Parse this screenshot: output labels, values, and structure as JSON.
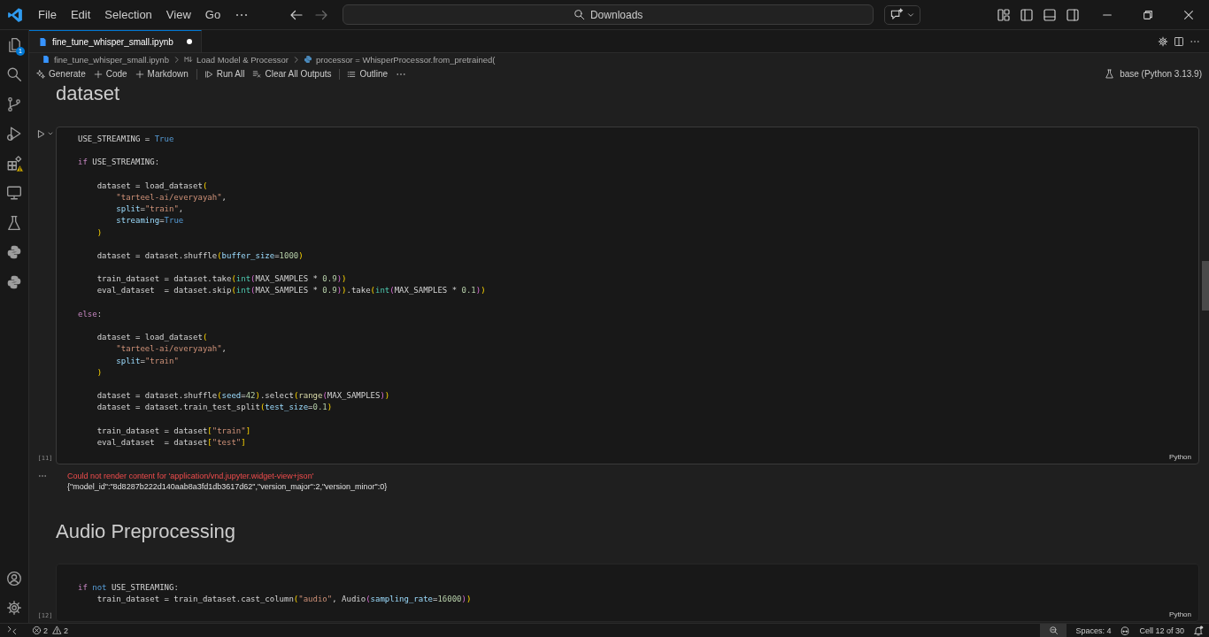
{
  "title_bar": {
    "menus": [
      "File",
      "Edit",
      "Selection",
      "View",
      "Go"
    ],
    "command_center": "Downloads"
  },
  "activity_bar": {
    "explorer_badge": "1"
  },
  "tabs": [
    {
      "label": "fine_tune_whisper_small.ipynb",
      "selected": true,
      "modified": true
    }
  ],
  "breadcrumbs": [
    {
      "text": "fine_tune_whisper_small.ipynb",
      "kind": "file"
    },
    {
      "text": "Load Model & Processor",
      "kind": "markdown"
    },
    {
      "text": "processor = WhisperProcessor.from_pretrained(",
      "kind": "python"
    }
  ],
  "toolbar": {
    "items": [
      {
        "label": "Generate",
        "kind": "sparkle"
      },
      {
        "label": "Code",
        "kind": "plus"
      },
      {
        "label": "Markdown",
        "kind": "plus"
      },
      {
        "label": "Run All",
        "kind": "run-all"
      },
      {
        "label": "Clear All Outputs",
        "kind": "clear"
      },
      {
        "label": "Outline",
        "kind": "list"
      }
    ],
    "kernel": "base (Python 3.13.9)"
  },
  "notebook": [
    {
      "kind": "heading",
      "text": "dataset"
    },
    {
      "kind": "code",
      "focused": true,
      "execution_count": "[11]",
      "language": "Python",
      "lines": [
        {
          "kind": "code",
          "tokens": [
            {
              "text": "USE_STREAMING = ",
              "kind": "plain"
            },
            {
              "text": "True",
              "kind": "const"
            }
          ]
        },
        {
          "kind": "blank"
        },
        {
          "kind": "code",
          "tokens": [
            {
              "text": "if",
              "kind": "kw"
            },
            {
              "text": " USE_STREAMING:",
              "kind": "plain"
            }
          ]
        },
        {
          "kind": "blank"
        },
        {
          "kind": "code",
          "tokens": [
            {
              "text": "    dataset = load_dataset",
              "kind": "plain"
            },
            {
              "text": "(",
              "kind": "b1"
            }
          ]
        },
        {
          "kind": "code",
          "tokens": [
            {
              "text": "        \"tarteel-ai/everyayah\"",
              "kind": "str"
            },
            {
              "text": ",",
              "kind": "plain"
            }
          ]
        },
        {
          "kind": "code",
          "tokens": [
            {
              "text": "        split",
              "kind": "param"
            },
            {
              "text": "=",
              "kind": "plain"
            },
            {
              "text": "\"train\"",
              "kind": "str"
            },
            {
              "text": ",",
              "kind": "plain"
            }
          ]
        },
        {
          "kind": "code",
          "tokens": [
            {
              "text": "        streaming",
              "kind": "param"
            },
            {
              "text": "=",
              "kind": "plain"
            },
            {
              "text": "True",
              "kind": "const"
            }
          ]
        },
        {
          "kind": "code",
          "tokens": [
            {
              "text": "    )",
              "kind": "b1"
            }
          ]
        },
        {
          "kind": "blank"
        },
        {
          "kind": "code",
          "tokens": [
            {
              "text": "    dataset = dataset.shuffle",
              "kind": "plain"
            },
            {
              "text": "(",
              "kind": "b1"
            },
            {
              "text": "buffer_size",
              "kind": "param"
            },
            {
              "text": "=",
              "kind": "plain"
            },
            {
              "text": "1000",
              "kind": "num"
            },
            {
              "text": ")",
              "kind": "b1"
            }
          ]
        },
        {
          "kind": "blank"
        },
        {
          "kind": "code",
          "tokens": [
            {
              "text": "    train_dataset = dataset.take",
              "kind": "plain"
            },
            {
              "text": "(",
              "kind": "b1"
            },
            {
              "text": "int",
              "kind": "cls"
            },
            {
              "text": "(",
              "kind": "b2"
            },
            {
              "text": "MAX_SAMPLES * ",
              "kind": "plain"
            },
            {
              "text": "0.9",
              "kind": "num"
            },
            {
              "text": ")",
              "kind": "b2"
            },
            {
              "text": ")",
              "kind": "b1"
            }
          ]
        },
        {
          "kind": "code",
          "tokens": [
            {
              "text": "    eval_dataset  = dataset.skip",
              "kind": "plain"
            },
            {
              "text": "(",
              "kind": "b1"
            },
            {
              "text": "int",
              "kind": "cls"
            },
            {
              "text": "(",
              "kind": "b2"
            },
            {
              "text": "MAX_SAMPLES * ",
              "kind": "plain"
            },
            {
              "text": "0.9",
              "kind": "num"
            },
            {
              "text": ")",
              "kind": "b2"
            },
            {
              "text": ")",
              "kind": "b1"
            },
            {
              "text": ".take",
              "kind": "plain"
            },
            {
              "text": "(",
              "kind": "b1"
            },
            {
              "text": "int",
              "kind": "cls"
            },
            {
              "text": "(",
              "kind": "b2"
            },
            {
              "text": "MAX_SAMPLES * ",
              "kind": "plain"
            },
            {
              "text": "0.1",
              "kind": "num"
            },
            {
              "text": ")",
              "kind": "b2"
            },
            {
              "text": ")",
              "kind": "b1"
            }
          ]
        },
        {
          "kind": "blank"
        },
        {
          "kind": "code",
          "tokens": [
            {
              "text": "else",
              "kind": "kw"
            },
            {
              "text": ":",
              "kind": "plain"
            }
          ]
        },
        {
          "kind": "blank"
        },
        {
          "kind": "code",
          "tokens": [
            {
              "text": "    dataset = load_dataset",
              "kind": "plain"
            },
            {
              "text": "(",
              "kind": "b1"
            }
          ]
        },
        {
          "kind": "code",
          "tokens": [
            {
              "text": "        \"tarteel-ai/everyayah\"",
              "kind": "str"
            },
            {
              "text": ",",
              "kind": "plain"
            }
          ]
        },
        {
          "kind": "code",
          "tokens": [
            {
              "text": "        split",
              "kind": "param"
            },
            {
              "text": "=",
              "kind": "plain"
            },
            {
              "text": "\"train\"",
              "kind": "str"
            }
          ]
        },
        {
          "kind": "code",
          "tokens": [
            {
              "text": "    )",
              "kind": "b1"
            }
          ]
        },
        {
          "kind": "blank"
        },
        {
          "kind": "code",
          "tokens": [
            {
              "text": "    dataset = dataset.shuffle",
              "kind": "plain"
            },
            {
              "text": "(",
              "kind": "b1"
            },
            {
              "text": "seed",
              "kind": "param"
            },
            {
              "text": "=",
              "kind": "plain"
            },
            {
              "text": "42",
              "kind": "num"
            },
            {
              "text": ")",
              "kind": "b1"
            },
            {
              "text": ".select",
              "kind": "plain"
            },
            {
              "text": "(",
              "kind": "b1"
            },
            {
              "text": "range",
              "kind": "fn"
            },
            {
              "text": "(",
              "kind": "b2"
            },
            {
              "text": "MAX_SAMPLES",
              "kind": "plain"
            },
            {
              "text": ")",
              "kind": "b2"
            },
            {
              "text": ")",
              "kind": "b1"
            }
          ]
        },
        {
          "kind": "code",
          "tokens": [
            {
              "text": "    dataset = dataset.train_test_split",
              "kind": "plain"
            },
            {
              "text": "(",
              "kind": "b1"
            },
            {
              "text": "test_size",
              "kind": "param"
            },
            {
              "text": "=",
              "kind": "plain"
            },
            {
              "text": "0.1",
              "kind": "num"
            },
            {
              "text": ")",
              "kind": "b1"
            }
          ]
        },
        {
          "kind": "blank"
        },
        {
          "kind": "code",
          "tokens": [
            {
              "text": "    train_dataset = dataset",
              "kind": "plain"
            },
            {
              "text": "[",
              "kind": "b1"
            },
            {
              "text": "\"train\"",
              "kind": "str"
            },
            {
              "text": "]",
              "kind": "b1"
            }
          ]
        },
        {
          "kind": "code",
          "tokens": [
            {
              "text": "    eval_dataset  = dataset",
              "kind": "plain"
            },
            {
              "text": "[",
              "kind": "b1"
            },
            {
              "text": "\"test\"",
              "kind": "str"
            },
            {
              "text": "]",
              "kind": "b1"
            }
          ]
        }
      ],
      "outputs": [
        {
          "error": "Could not render content for 'application/vnd.jupyter.widget-view+json'",
          "text": "{\"model_id\":\"8d8287b222d140aab8a3fd1db3617d62\",\"version_major\":2,\"version_minor\":0}"
        }
      ]
    },
    {
      "kind": "heading",
      "text": "Audio Preprocessing"
    },
    {
      "kind": "code",
      "focused": false,
      "execution_count": "[12]",
      "language": "Python",
      "lines": [
        {
          "kind": "blank"
        },
        {
          "kind": "code",
          "tokens": [
            {
              "text": "if",
              "kind": "kw"
            },
            {
              "text": " not",
              "kind": "const"
            },
            {
              "text": " USE_STREAMING:",
              "kind": "plain"
            }
          ]
        },
        {
          "kind": "code",
          "tokens": [
            {
              "text": "    train_dataset = train_dataset.cast_column",
              "kind": "plain"
            },
            {
              "text": "(",
              "kind": "b1"
            },
            {
              "text": "\"audio\"",
              "kind": "str"
            },
            {
              "text": ", Audio",
              "kind": "plain"
            },
            {
              "text": "(",
              "kind": "b2"
            },
            {
              "text": "sampling_rate",
              "kind": "param"
            },
            {
              "text": "=",
              "kind": "plain"
            },
            {
              "text": "16000",
              "kind": "num"
            },
            {
              "text": ")",
              "kind": "b2"
            },
            {
              "text": ")",
              "kind": "b1"
            }
          ]
        }
      ]
    }
  ],
  "status_bar": {
    "errors": "2",
    "warnings": "2",
    "spaces": "Spaces: 4",
    "cell": "Cell 12 of 30"
  }
}
